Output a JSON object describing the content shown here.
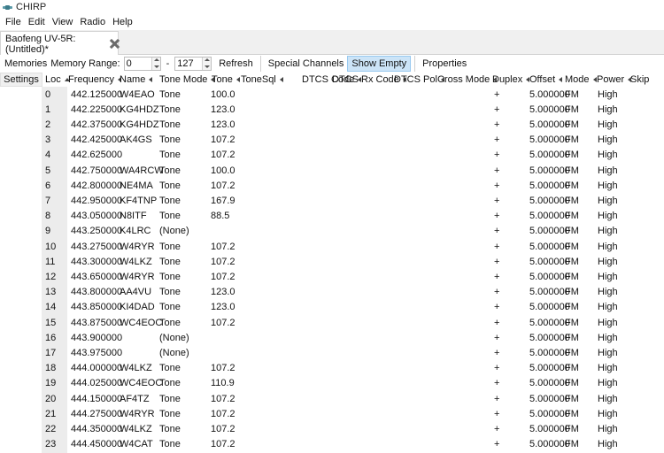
{
  "window": {
    "title": "CHIRP",
    "icon": "chirp-app-icon"
  },
  "menubar": {
    "items": [
      "File",
      "Edit",
      "View",
      "Radio",
      "Help"
    ]
  },
  "tabs": [
    {
      "label": "Baofeng UV-5R: (Untitled)*",
      "close_icon": "close-icon"
    }
  ],
  "toolbar": {
    "memories_label": "Memories",
    "memory_range_label": "Memory Range:",
    "range_start": "0",
    "range_separator": "-",
    "range_end": "127",
    "refresh_label": "Refresh",
    "special_channels_label": "Special Channels",
    "show_empty_label": "Show Empty",
    "properties_label": "Properties"
  },
  "sidebar": {
    "settings_label": "Settings"
  },
  "grid": {
    "columns": [
      "Loc",
      "Frequency",
      "Name",
      "Tone Mode",
      "Tone",
      "ToneSql",
      "DTCS Code",
      "DTCS Rx Code",
      "DTCS Pol",
      "Cross Mode",
      "Duplex",
      "Offset",
      "Mode",
      "Power",
      "Skip"
    ],
    "sorted_column": "Loc",
    "rows": [
      {
        "loc": "0",
        "freq": "442.125000",
        "name": "W4EAO",
        "tone_mode": "Tone",
        "tone": "100.0",
        "duplex": "+",
        "offset": "5.000000",
        "mode": "FM",
        "power": "High"
      },
      {
        "loc": "1",
        "freq": "442.225000",
        "name": "KG4HDZ",
        "tone_mode": "Tone",
        "tone": "123.0",
        "duplex": "+",
        "offset": "5.000000",
        "mode": "FM",
        "power": "High"
      },
      {
        "loc": "2",
        "freq": "442.375000",
        "name": "KG4HDZ",
        "tone_mode": "Tone",
        "tone": "123.0",
        "duplex": "+",
        "offset": "5.000000",
        "mode": "FM",
        "power": "High"
      },
      {
        "loc": "3",
        "freq": "442.425000",
        "name": "AK4GS",
        "tone_mode": "Tone",
        "tone": "107.2",
        "duplex": "+",
        "offset": "5.000000",
        "mode": "FM",
        "power": "High"
      },
      {
        "loc": "4",
        "freq": "442.625000",
        "name": "",
        "tone_mode": "Tone",
        "tone": "107.2",
        "duplex": "+",
        "offset": "5.000000",
        "mode": "FM",
        "power": "High"
      },
      {
        "loc": "5",
        "freq": "442.750000",
        "name": "WA4RCW",
        "tone_mode": "Tone",
        "tone": "100.0",
        "duplex": "+",
        "offset": "5.000000",
        "mode": "FM",
        "power": "High"
      },
      {
        "loc": "6",
        "freq": "442.800000",
        "name": "NE4MA",
        "tone_mode": "Tone",
        "tone": "107.2",
        "duplex": "+",
        "offset": "5.000000",
        "mode": "FM",
        "power": "High"
      },
      {
        "loc": "7",
        "freq": "442.950000",
        "name": "KF4TNP",
        "tone_mode": "Tone",
        "tone": "167.9",
        "duplex": "+",
        "offset": "5.000000",
        "mode": "FM",
        "power": "High"
      },
      {
        "loc": "8",
        "freq": "443.050000",
        "name": "N8ITF",
        "tone_mode": "Tone",
        "tone": "88.5",
        "duplex": "+",
        "offset": "5.000000",
        "mode": "FM",
        "power": "High"
      },
      {
        "loc": "9",
        "freq": "443.250000",
        "name": "K4LRC",
        "tone_mode": "(None)",
        "tone": "",
        "duplex": "+",
        "offset": "5.000000",
        "mode": "FM",
        "power": "High"
      },
      {
        "loc": "10",
        "freq": "443.275000",
        "name": "W4RYR",
        "tone_mode": "Tone",
        "tone": "107.2",
        "duplex": "+",
        "offset": "5.000000",
        "mode": "FM",
        "power": "High"
      },
      {
        "loc": "11",
        "freq": "443.300000",
        "name": "W4LKZ",
        "tone_mode": "Tone",
        "tone": "107.2",
        "duplex": "+",
        "offset": "5.000000",
        "mode": "FM",
        "power": "High"
      },
      {
        "loc": "12",
        "freq": "443.650000",
        "name": "W4RYR",
        "tone_mode": "Tone",
        "tone": "107.2",
        "duplex": "+",
        "offset": "5.000000",
        "mode": "FM",
        "power": "High"
      },
      {
        "loc": "13",
        "freq": "443.800000",
        "name": "AA4VU",
        "tone_mode": "Tone",
        "tone": "123.0",
        "duplex": "+",
        "offset": "5.000000",
        "mode": "FM",
        "power": "High"
      },
      {
        "loc": "14",
        "freq": "443.850000",
        "name": "KI4DAD",
        "tone_mode": "Tone",
        "tone": "123.0",
        "duplex": "+",
        "offset": "5.000000",
        "mode": "FM",
        "power": "High"
      },
      {
        "loc": "15",
        "freq": "443.875000",
        "name": "WC4EOC",
        "tone_mode": "Tone",
        "tone": "107.2",
        "duplex": "+",
        "offset": "5.000000",
        "mode": "FM",
        "power": "High"
      },
      {
        "loc": "16",
        "freq": "443.900000",
        "name": "",
        "tone_mode": "(None)",
        "tone": "",
        "duplex": "+",
        "offset": "5.000000",
        "mode": "FM",
        "power": "High"
      },
      {
        "loc": "17",
        "freq": "443.975000",
        "name": "",
        "tone_mode": "(None)",
        "tone": "",
        "duplex": "+",
        "offset": "5.000000",
        "mode": "FM",
        "power": "High"
      },
      {
        "loc": "18",
        "freq": "444.000000",
        "name": "W4LKZ",
        "tone_mode": "Tone",
        "tone": "107.2",
        "duplex": "+",
        "offset": "5.000000",
        "mode": "FM",
        "power": "High"
      },
      {
        "loc": "19",
        "freq": "444.025000",
        "name": "WC4EOC",
        "tone_mode": "Tone",
        "tone": "110.9",
        "duplex": "+",
        "offset": "5.000000",
        "mode": "FM",
        "power": "High"
      },
      {
        "loc": "20",
        "freq": "444.150000",
        "name": "AF4TZ",
        "tone_mode": "Tone",
        "tone": "107.2",
        "duplex": "+",
        "offset": "5.000000",
        "mode": "FM",
        "power": "High"
      },
      {
        "loc": "21",
        "freq": "444.275000",
        "name": "W4RYR",
        "tone_mode": "Tone",
        "tone": "107.2",
        "duplex": "+",
        "offset": "5.000000",
        "mode": "FM",
        "power": "High"
      },
      {
        "loc": "22",
        "freq": "444.350000",
        "name": "W4LKZ",
        "tone_mode": "Tone",
        "tone": "107.2",
        "duplex": "+",
        "offset": "5.000000",
        "mode": "FM",
        "power": "High"
      },
      {
        "loc": "23",
        "freq": "444.450000",
        "name": "W4CAT",
        "tone_mode": "Tone",
        "tone": "107.2",
        "duplex": "+",
        "offset": "5.000000",
        "mode": "FM",
        "power": "High"
      }
    ]
  }
}
